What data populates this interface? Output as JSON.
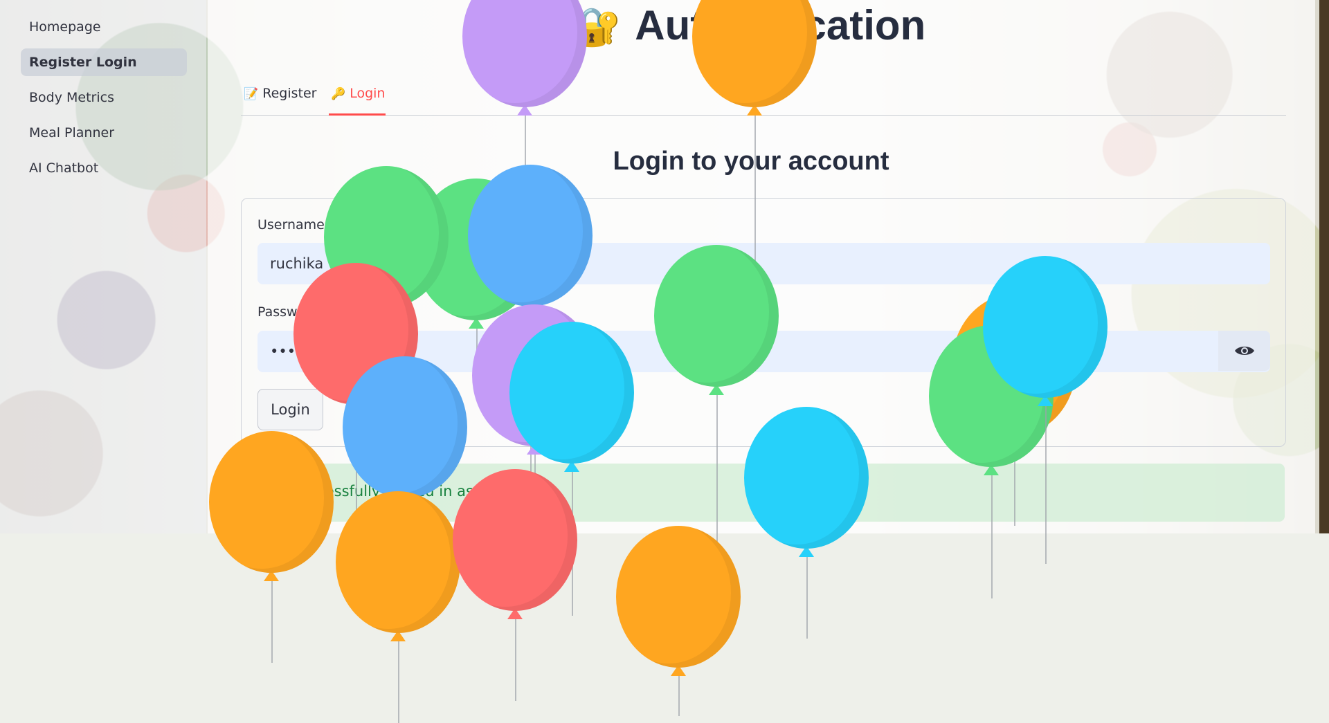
{
  "sidebar": {
    "items": [
      {
        "label": "Homepage",
        "active": false
      },
      {
        "label": "Register Login",
        "active": true
      },
      {
        "label": "Body Metrics",
        "active": false
      },
      {
        "label": "Meal Planner",
        "active": false
      },
      {
        "label": "AI Chatbot",
        "active": false
      }
    ]
  },
  "header": {
    "title": "Authentication",
    "title_icon": "🔐"
  },
  "tabs": [
    {
      "label": "Register",
      "icon": "📝",
      "active": false
    },
    {
      "label": "Login",
      "icon": "🔑",
      "active": true
    }
  ],
  "login": {
    "heading": "Login to your account",
    "username_label": "Username or Email",
    "username_value": "ruchika",
    "password_label": "Password",
    "password_value": "••••••",
    "show_password_icon": "eye-icon",
    "submit_label": "Login"
  },
  "status": {
    "success_message": "Successfully logged in as Ru"
  },
  "colors": {
    "accent": "#ff4b4b",
    "input_bg": "#e8f0fe",
    "success_text": "#17803d",
    "balloon_colors": [
      "#c49bf7",
      "#ffa620",
      "#5ce182",
      "#5db0fb",
      "#fe6b6b",
      "#26d1fa"
    ]
  }
}
